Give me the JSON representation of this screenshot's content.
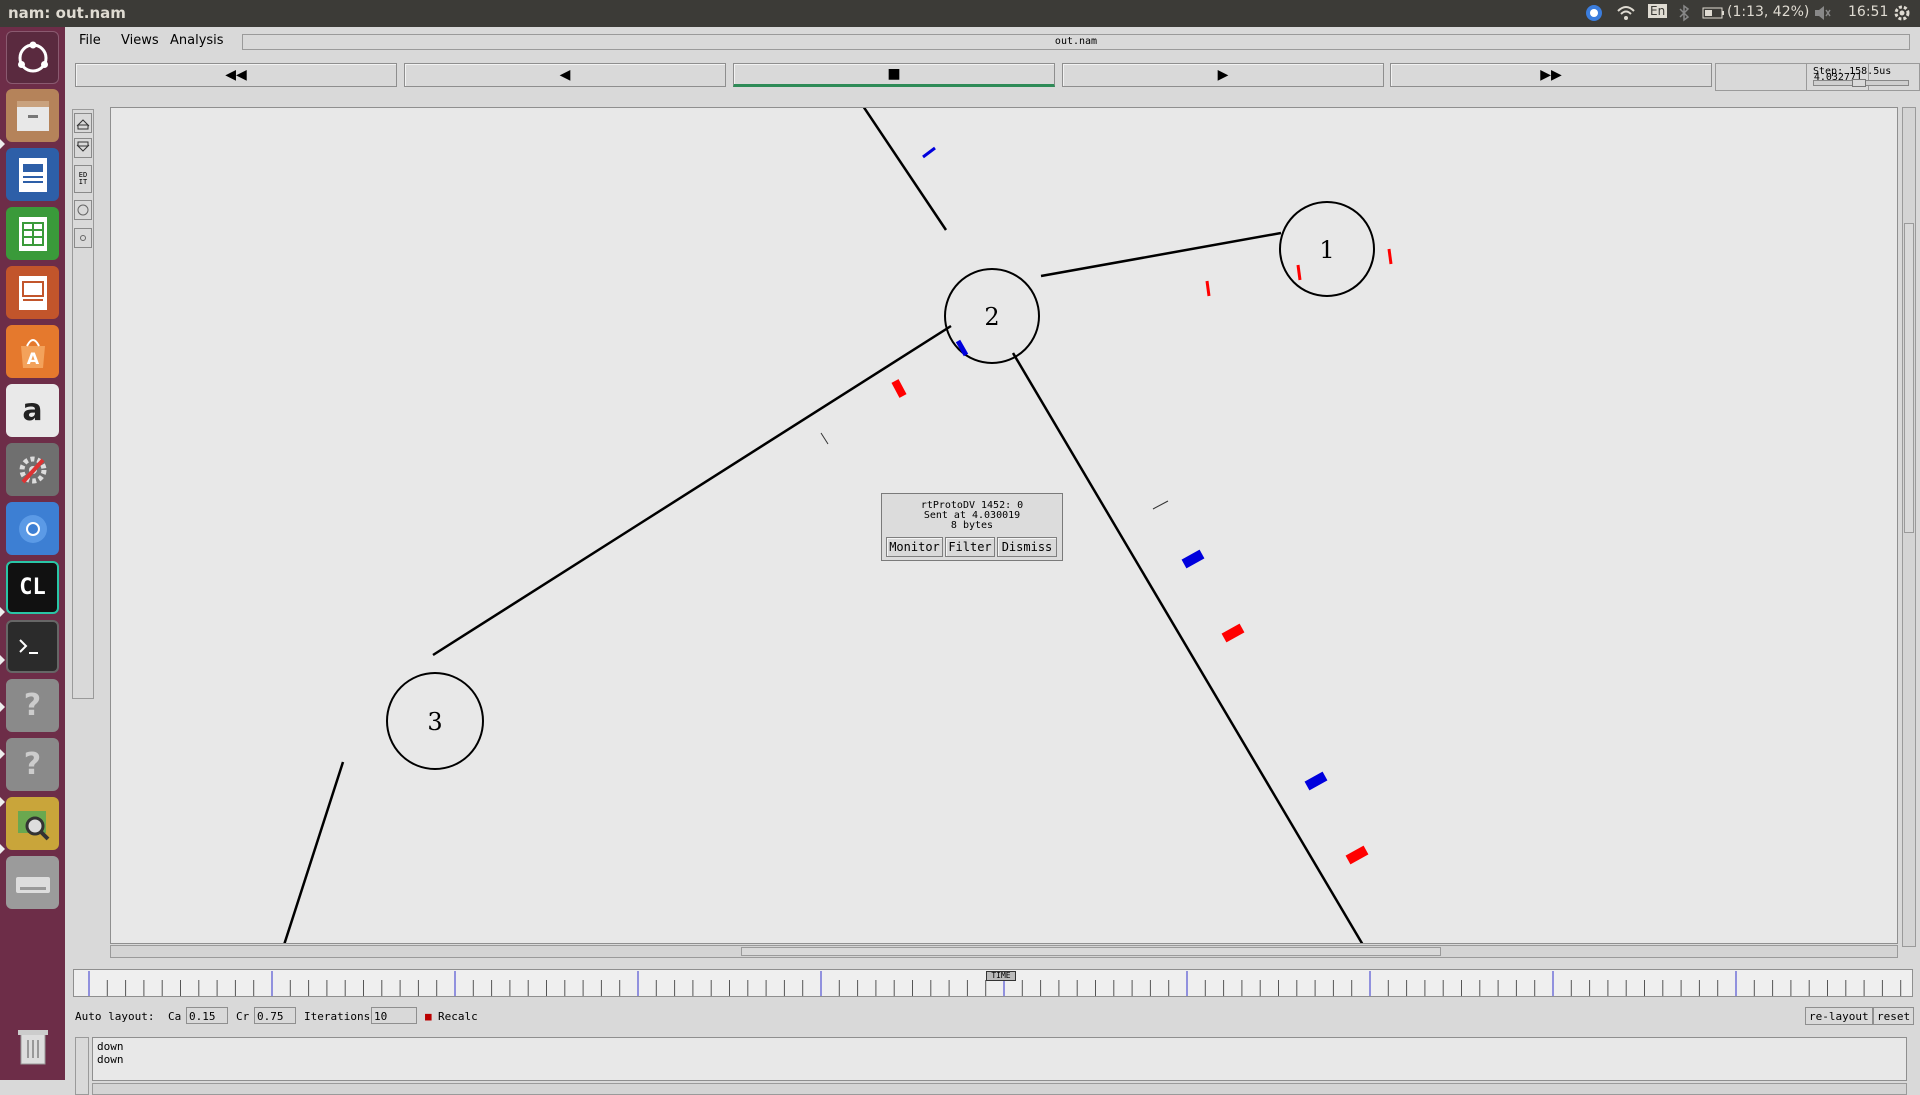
{
  "system_bar": {
    "title": "nam: out.nam",
    "keyboard": "En",
    "battery": "(1:13, 42%)",
    "time": "16:51"
  },
  "launcher": {
    "items": [
      "files-icon",
      "writer-icon",
      "calc-icon",
      "impress-icon",
      "software-center-icon",
      "amazon-icon",
      "system-settings-icon",
      "chromium-icon",
      "clion-icon",
      "terminal-icon",
      "unknown-app-icon",
      "unknown-app-icon",
      "image-viewer-icon",
      "drive-icon"
    ],
    "clion_label": "CL",
    "trash": "trash-icon"
  },
  "menubar": {
    "file": "File",
    "views": "Views",
    "analysis": "Analysis",
    "filename": "out.nam"
  },
  "controls": {
    "rewind": "◀◀",
    "back": "◀",
    "stop": "■",
    "play": "▶",
    "fast_forward": "▶▶",
    "time": "4.032771",
    "step": "Step: 158.5us"
  },
  "tools": {
    "edit": "ED IT"
  },
  "nodes": [
    {
      "id": "1",
      "label": "1"
    },
    {
      "id": "2",
      "label": "2"
    },
    {
      "id": "3",
      "label": "3"
    }
  ],
  "popup": {
    "line1": "rtProtoDV 1452: 0",
    "line2": "Sent at 4.030019",
    "line3": "8 bytes",
    "monitor": "Monitor",
    "filter": "Filter",
    "dismiss": "Dismiss"
  },
  "timeline": {
    "tag": "TIME"
  },
  "autolayout": {
    "label": "Auto layout:",
    "ca_label": "Ca",
    "ca_value": "0.15",
    "cr_label": "Cr",
    "cr_value": "0.75",
    "iter_label": "Iterations",
    "iter_value": "10",
    "recalc": "Recalc",
    "relayout": "re-layout",
    "reset": "reset"
  },
  "log": {
    "lines": [
      "down",
      "down"
    ]
  },
  "colors": {
    "packet_red": "#ff0000",
    "packet_blue": "#0000dd",
    "launcher_bg": "#6d2d48",
    "topbar_bg": "#3c3b37"
  }
}
